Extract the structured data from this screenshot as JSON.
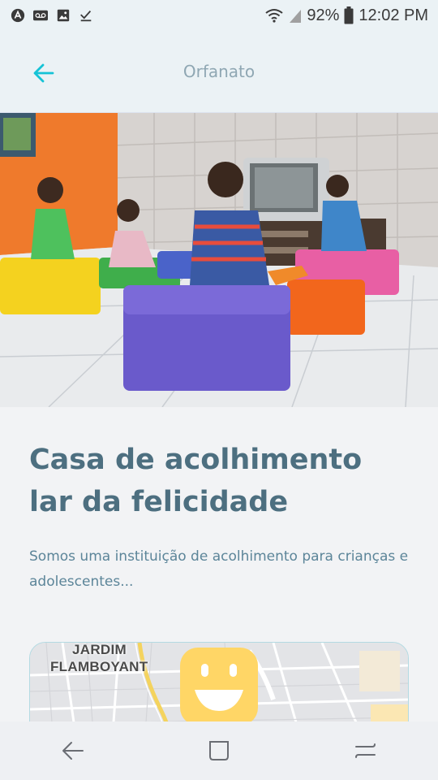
{
  "status_bar": {
    "battery": "92%",
    "time": "12:02 PM",
    "icons": [
      "app-icon",
      "voicemail-icon",
      "image-icon",
      "check-icon",
      "wifi-icon",
      "signal-icon",
      "battery-icon"
    ]
  },
  "header": {
    "title": "Orfanato",
    "back_icon": "arrow-left-icon",
    "accent_color": "#15c3d6"
  },
  "orphanage": {
    "name": "Casa de acolhimento lar da felicidade",
    "about": "Somos uma instituição de acolhimento para crianças e adolescentes..."
  },
  "map": {
    "labels": [
      "JARDIM",
      "FLAMBOYANT"
    ],
    "marker_icon": "smile-icon",
    "marker_color": "#ffd666"
  },
  "nav_bar": {
    "icons": [
      "back-nav-icon",
      "home-nav-icon",
      "recents-nav-icon"
    ]
  }
}
